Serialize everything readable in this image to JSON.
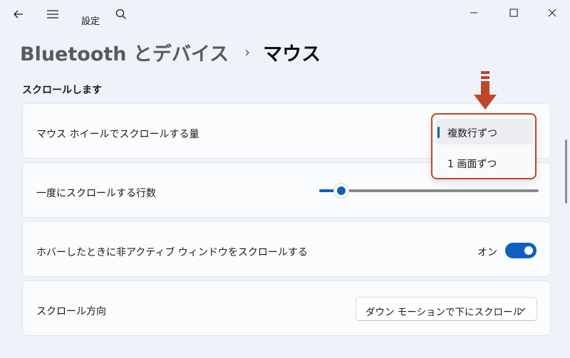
{
  "window": {
    "title": "設定",
    "back_icon": "back-arrow-icon",
    "menu_icon": "hamburger-menu-icon",
    "search_icon": "search-icon",
    "minimize_icon": "minimize-icon",
    "maximize_icon": "maximize-icon",
    "close_icon": "close-icon"
  },
  "breadcrumb": {
    "parent": "Bluetooth とデバイス",
    "separator": "›",
    "current": "マウス"
  },
  "section": {
    "title": "スクロールします"
  },
  "settings": {
    "scroll_amount": {
      "label": "マウス ホイールでスクロールする量",
      "options": [
        {
          "label": "複数行ずつ",
          "selected": true
        },
        {
          "label": "1 画面ずつ",
          "selected": false
        }
      ]
    },
    "lines_per_scroll": {
      "label": "一度にスクロールする行数",
      "value_fraction": 0.1
    },
    "inactive_scroll": {
      "label": "ホバーしたときに非アクティブ ウィンドウをスクロールする",
      "state_label": "オン",
      "on": true
    },
    "scroll_direction": {
      "label": "スクロール方向",
      "value": "ダウン モーションで下にスクロール",
      "chevron_icon": "chevron-down-icon"
    }
  },
  "annotation": {
    "arrow_icon": "down-arrow-annotation-icon",
    "highlight_color": "#c0462a"
  },
  "colors": {
    "accent": "#0e5fbf",
    "background": "#eef3f9",
    "card": "#fbfcfd"
  }
}
